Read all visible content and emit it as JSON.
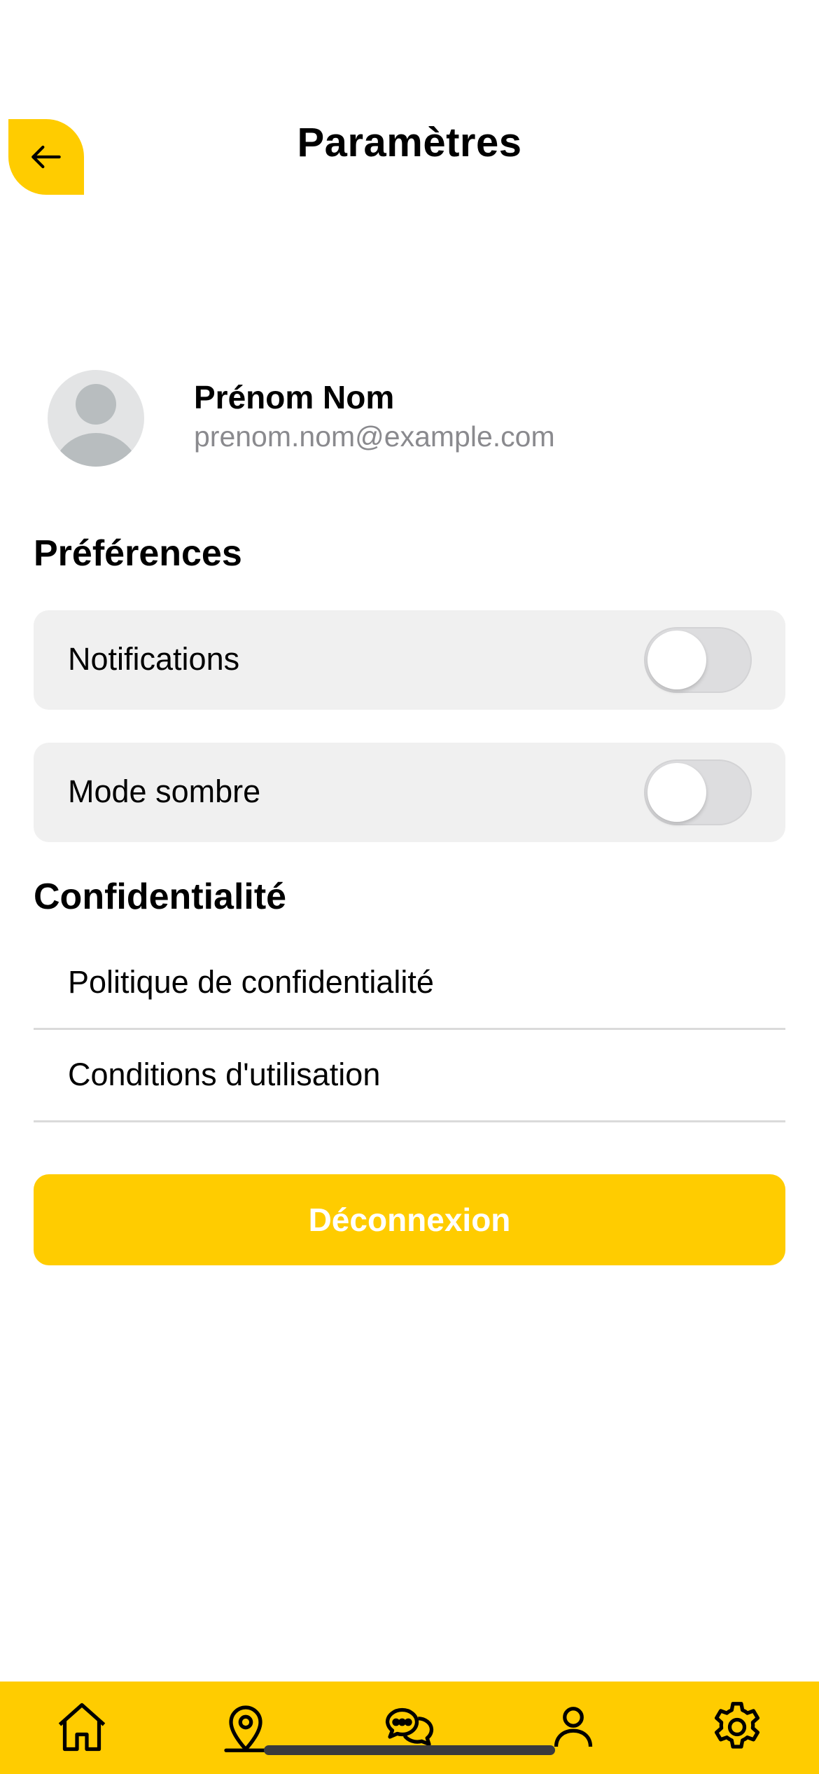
{
  "header": {
    "title": "Paramètres",
    "back_icon": "arrow-left-icon"
  },
  "profile": {
    "name": "Prénom Nom",
    "email": "prenom.nom@example.com",
    "avatar_icon": "user-placeholder-icon"
  },
  "preferences": {
    "title": "Préférences",
    "items": [
      {
        "label": "Notifications",
        "enabled": false
      },
      {
        "label": "Mode sombre",
        "enabled": false
      }
    ]
  },
  "privacy": {
    "title": "Confidentialité",
    "links": [
      {
        "label": "Politique de confidentialité"
      },
      {
        "label": "Conditions d'utilisation"
      }
    ]
  },
  "logout": {
    "label": "Déconnexion"
  },
  "bottom_nav": {
    "items": [
      {
        "icon": "home-icon"
      },
      {
        "icon": "map-pin-icon"
      },
      {
        "icon": "chat-bubbles-icon"
      },
      {
        "icon": "person-icon"
      },
      {
        "icon": "gear-icon"
      }
    ]
  },
  "colors": {
    "accent": "#FFCC00",
    "row_bg": "#F0F0F0",
    "toggle_off": "#DDDDDF",
    "muted_text": "#8A8A8E"
  }
}
